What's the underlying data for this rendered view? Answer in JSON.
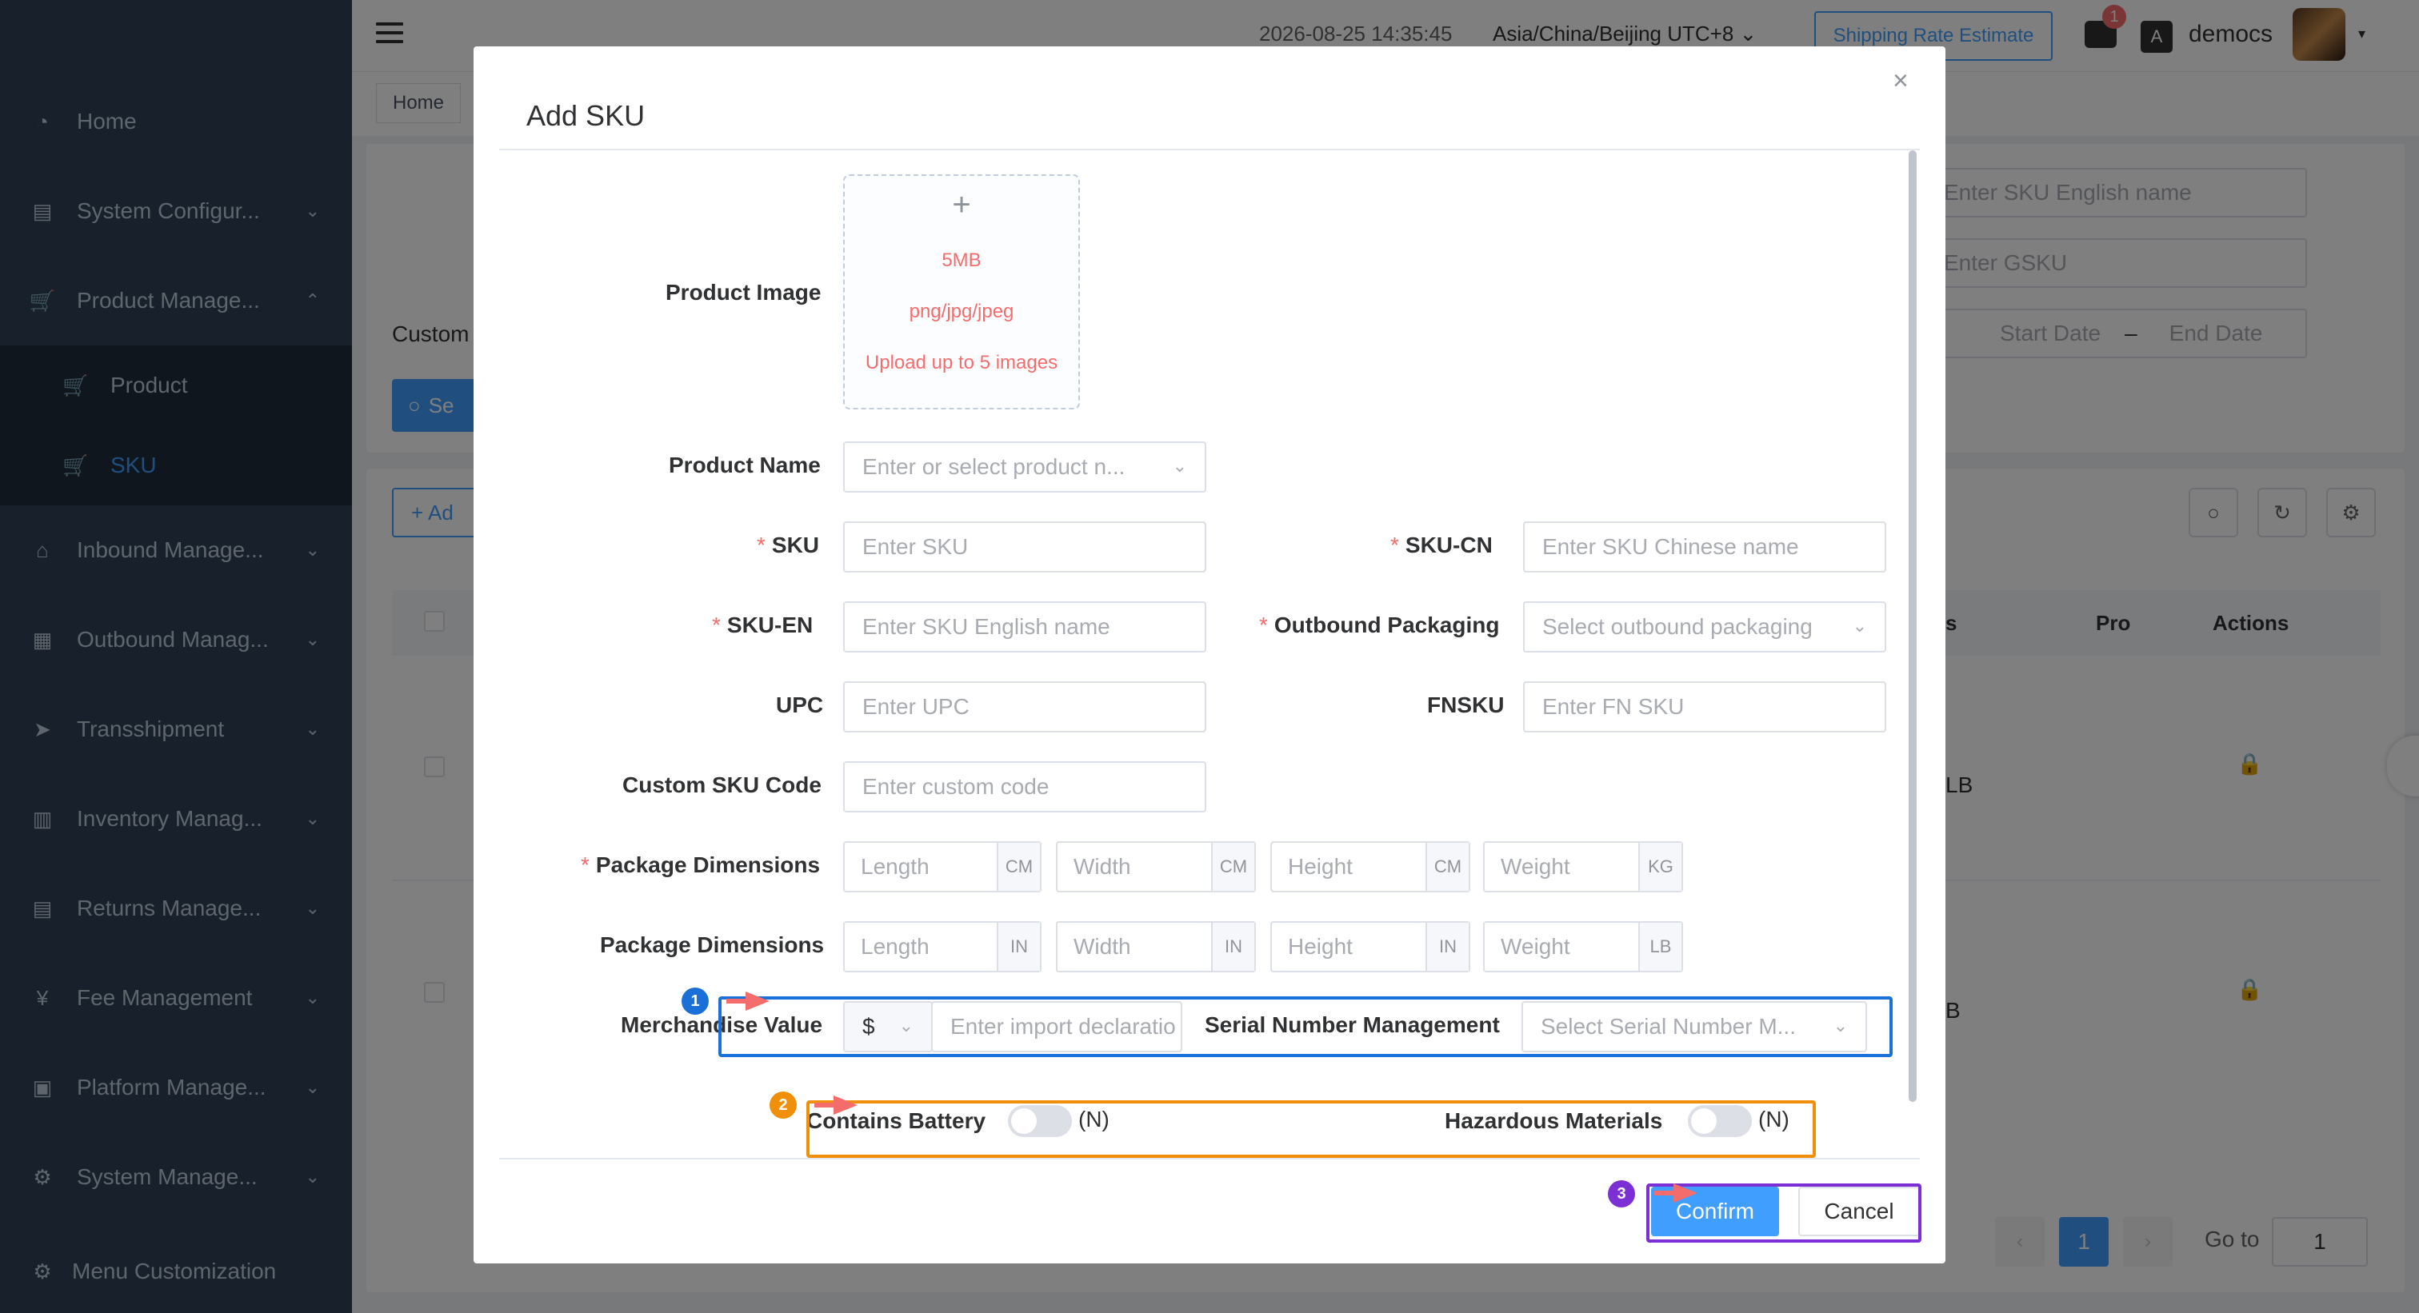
{
  "sidebar": {
    "items": [
      {
        "label": "Home",
        "icon": "dashboard-icon",
        "glyph": "◔",
        "chevron": ""
      },
      {
        "label": "System Configur...",
        "icon": "settings-list-icon",
        "glyph": "▤",
        "chevron": "⌄"
      },
      {
        "label": "Product Manage...",
        "icon": "cart-icon",
        "glyph": "🛒",
        "chevron": "⌃"
      },
      {
        "label": "Inbound Manage...",
        "icon": "home-icon",
        "glyph": "⌂",
        "chevron": "⌄"
      },
      {
        "label": "Outbound Manag...",
        "icon": "grid-icon",
        "glyph": "▦",
        "chevron": "⌄"
      },
      {
        "label": "Transshipment",
        "icon": "send-icon",
        "glyph": "➤",
        "chevron": "⌄"
      },
      {
        "label": "Inventory Manag...",
        "icon": "table-icon",
        "glyph": "▥",
        "chevron": "⌄"
      },
      {
        "label": "Returns Manage...",
        "icon": "clipboard-icon",
        "glyph": "▤",
        "chevron": "⌄"
      },
      {
        "label": "Fee Management",
        "icon": "yen-icon",
        "glyph": "¥",
        "chevron": "⌄"
      },
      {
        "label": "Platform Manage...",
        "icon": "calendar-icon",
        "glyph": "▣",
        "chevron": "⌄"
      },
      {
        "label": "System Manage...",
        "icon": "gear-icon",
        "glyph": "⚙",
        "chevron": "⌄"
      },
      {
        "label": "Menu Customization",
        "icon": "gear-outline-icon",
        "glyph": "⚙",
        "chevron": ""
      }
    ],
    "sub_items": [
      {
        "label": "Product",
        "icon": "cart-icon",
        "glyph": "🛒"
      },
      {
        "label": "SKU",
        "icon": "cart-icon",
        "glyph": "🛒"
      }
    ],
    "colors": {
      "bg": "#304156",
      "active_text": "#409eff"
    }
  },
  "header": {
    "datetime": "2026-08-25 14:35:45",
    "timezone": "Asia/China/Beijing UTC+8 ⌄",
    "shipping_button": "Shipping Rate Estimate",
    "message_badge": "1",
    "lang_glyph": "A",
    "username": "democs",
    "caret": "▾"
  },
  "background": {
    "tab_home": "Home",
    "custom_label": "Custom",
    "search_btn": "Se",
    "search_glyph": "○",
    "add_btn": "+ Ad",
    "filters": {
      "sku_en_placeholder": "Enter SKU English name",
      "gsku_placeholder": "Enter GSKU",
      "start_date": "Start Date",
      "dash": "–",
      "end_date": "End Date"
    },
    "table": {
      "col_partial_s": "s",
      "col_partial_pro": "Pro",
      "col_actions": "Actions",
      "row1_unit": "LB",
      "row2_unit": "B"
    },
    "tools": {
      "search": "○",
      "refresh": "↻",
      "settings": "⚙"
    },
    "pager": {
      "prev": "‹",
      "page": "1",
      "next": "›",
      "goto_label": "Go to",
      "goto_value": "1"
    },
    "lock_glyph": "🔒"
  },
  "modal": {
    "title": "Add SKU",
    "close_glyph": "×",
    "product_image": {
      "label": "Product Image",
      "plus": "+",
      "size": "5MB",
      "types": "png/jpg/jpeg",
      "limit": "Upload up to 5 images"
    },
    "fields": {
      "product_name": {
        "label": "Product Name",
        "placeholder": "Enter or select product n..."
      },
      "sku": {
        "label": "SKU",
        "placeholder": "Enter SKU"
      },
      "sku_cn": {
        "label": "SKU-CN",
        "placeholder": "Enter SKU Chinese name"
      },
      "sku_en": {
        "label": "SKU-EN",
        "placeholder": "Enter SKU English name"
      },
      "outbound_packaging": {
        "label": "Outbound Packaging",
        "placeholder": "Select outbound packaging"
      },
      "upc": {
        "label": "UPC",
        "placeholder": "Enter UPC"
      },
      "fnsku": {
        "label": "FNSKU",
        "placeholder": "Enter FN SKU"
      },
      "custom_sku_code": {
        "label": "Custom SKU Code",
        "placeholder": "Enter custom code"
      },
      "package_dims_metric": {
        "label": "Package Dimensions",
        "inputs": [
          {
            "placeholder": "Length",
            "unit": "CM"
          },
          {
            "placeholder": "Width",
            "unit": "CM"
          },
          {
            "placeholder": "Height",
            "unit": "CM"
          },
          {
            "placeholder": "Weight",
            "unit": "KG"
          }
        ]
      },
      "package_dims_imperial": {
        "label": "Package Dimensions",
        "inputs": [
          {
            "placeholder": "Length",
            "unit": "IN"
          },
          {
            "placeholder": "Width",
            "unit": "IN"
          },
          {
            "placeholder": "Height",
            "unit": "IN"
          },
          {
            "placeholder": "Weight",
            "unit": "LB"
          }
        ]
      },
      "merchandise_value": {
        "label": "Merchandise Value",
        "currency": "$",
        "placeholder": "Enter import declaratio"
      },
      "serial_number": {
        "label": "Serial Number Management",
        "placeholder": "Select Serial Number M..."
      },
      "contains_battery": {
        "label": "Contains Battery",
        "state": "(N)"
      },
      "hazardous_materials": {
        "label": "Hazardous Materials",
        "state": "(N)"
      }
    },
    "required_mark": "*",
    "dropdown_glyph": "⌄",
    "confirm": "Confirm",
    "cancel": "Cancel"
  },
  "annotations": [
    {
      "number": "1",
      "color": "#1a6fd8"
    },
    {
      "number": "2",
      "color": "#f0900a"
    },
    {
      "number": "3",
      "color": "#7b2fd4"
    }
  ]
}
